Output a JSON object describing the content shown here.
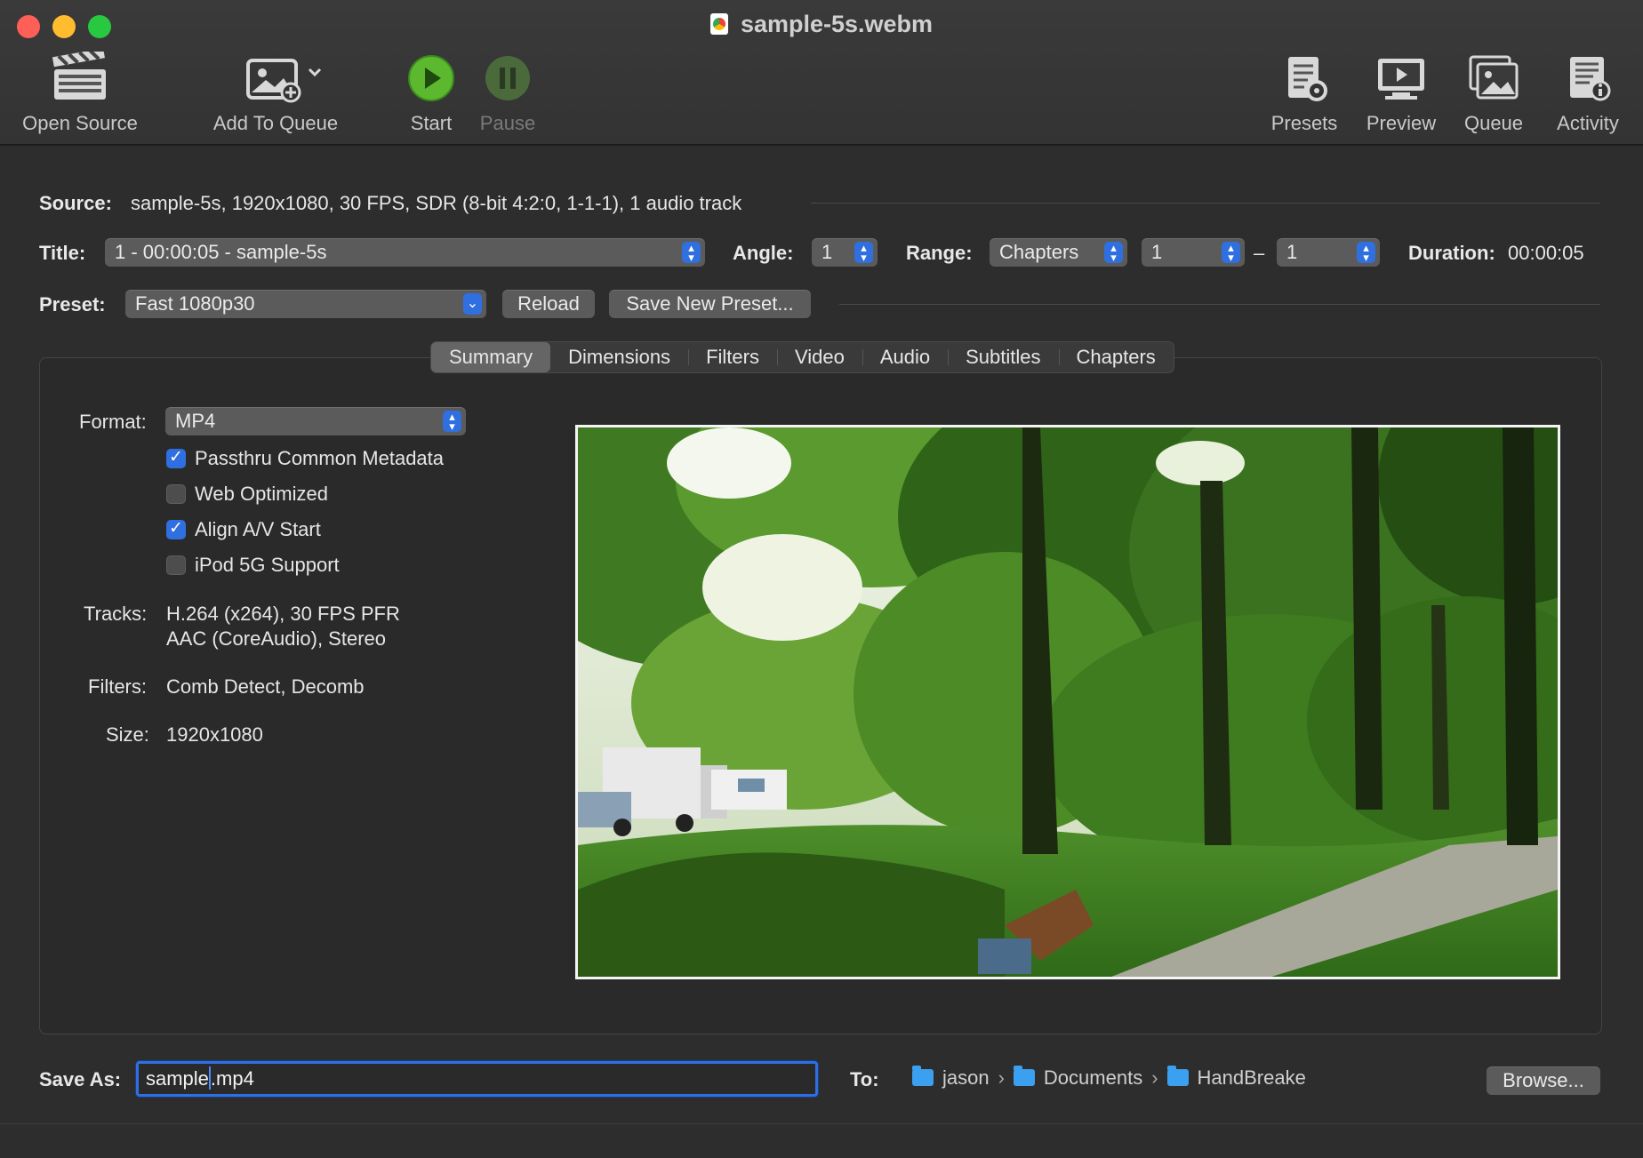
{
  "window": {
    "title": "sample-5s.webm"
  },
  "toolbar": {
    "open_source": "Open Source",
    "add_to_queue": "Add To Queue",
    "start": "Start",
    "pause": "Pause",
    "presets": "Presets",
    "preview": "Preview",
    "queue": "Queue",
    "activity": "Activity"
  },
  "source": {
    "label": "Source:",
    "value": "sample-5s, 1920x1080, 30 FPS, SDR (8-bit 4:2:0, 1-1-1), 1 audio track"
  },
  "title_row": {
    "title_label": "Title:",
    "title_value": "1 - 00:00:05 - sample-5s",
    "angle_label": "Angle:",
    "angle_value": "1",
    "range_label": "Range:",
    "range_type": "Chapters",
    "range_start": "1",
    "range_dash": "–",
    "range_end": "1",
    "duration_label": "Duration:",
    "duration_value": "00:00:05"
  },
  "preset_row": {
    "label": "Preset:",
    "value": "Fast 1080p30",
    "reload": "Reload",
    "save_new": "Save New Preset..."
  },
  "tabs": [
    "Summary",
    "Dimensions",
    "Filters",
    "Video",
    "Audio",
    "Subtitles",
    "Chapters"
  ],
  "active_tab": "Summary",
  "summary": {
    "format_label": "Format:",
    "format_value": "MP4",
    "options": [
      {
        "label": "Passthru Common Metadata",
        "checked": true
      },
      {
        "label": "Web Optimized",
        "checked": false
      },
      {
        "label": "Align A/V Start",
        "checked": true
      },
      {
        "label": "iPod 5G Support",
        "checked": false
      }
    ],
    "tracks_label": "Tracks:",
    "tracks_line1": "H.264 (x264), 30 FPS PFR",
    "tracks_line2": "AAC (CoreAudio), Stereo",
    "filters_label": "Filters:",
    "filters_value": "Comb Detect, Decomb",
    "size_label": "Size:",
    "size_value": "1920x1080"
  },
  "save": {
    "label": "Save As:",
    "value_before_caret": "sample",
    "value_after_caret": ".mp4",
    "to_label": "To:",
    "path": [
      "jason",
      "Documents",
      "HandBreake"
    ],
    "browse": "Browse..."
  },
  "colors": {
    "accent": "#2f6fe0",
    "start_green": "#5cb82e",
    "folder_blue": "#3aa0ef"
  }
}
